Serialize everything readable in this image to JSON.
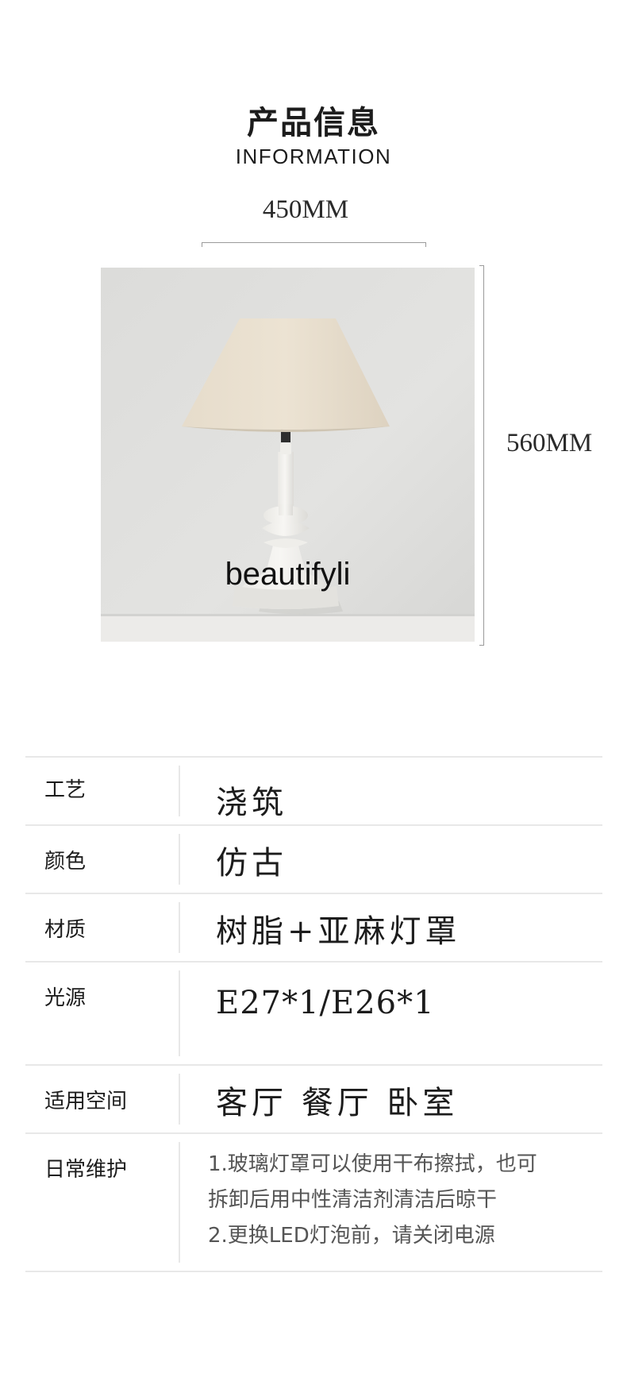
{
  "header": {
    "title_cn": "产品信息",
    "title_en": "INFORMATION"
  },
  "dimensions": {
    "width": "450MM",
    "height": "560MM"
  },
  "photo": {
    "watermark": "beautifyli"
  },
  "specs": [
    {
      "label": "工艺",
      "value": "浇筑"
    },
    {
      "label": "颜色",
      "value": "仿古"
    },
    {
      "label": "材质",
      "value": "树脂+亚麻灯罩"
    },
    {
      "label": "光源",
      "value": "E27*1/E26*1"
    },
    {
      "label": "适用空间",
      "value": "客厅 餐厅 卧室"
    },
    {
      "label": "日常维护",
      "lines": [
        "1.玻璃灯罩可以使用干布擦拭，也可",
        "拆卸后用中性清洁剂清洁后晾干",
        "2.更换LED灯泡前，请关闭电源"
      ]
    }
  ]
}
